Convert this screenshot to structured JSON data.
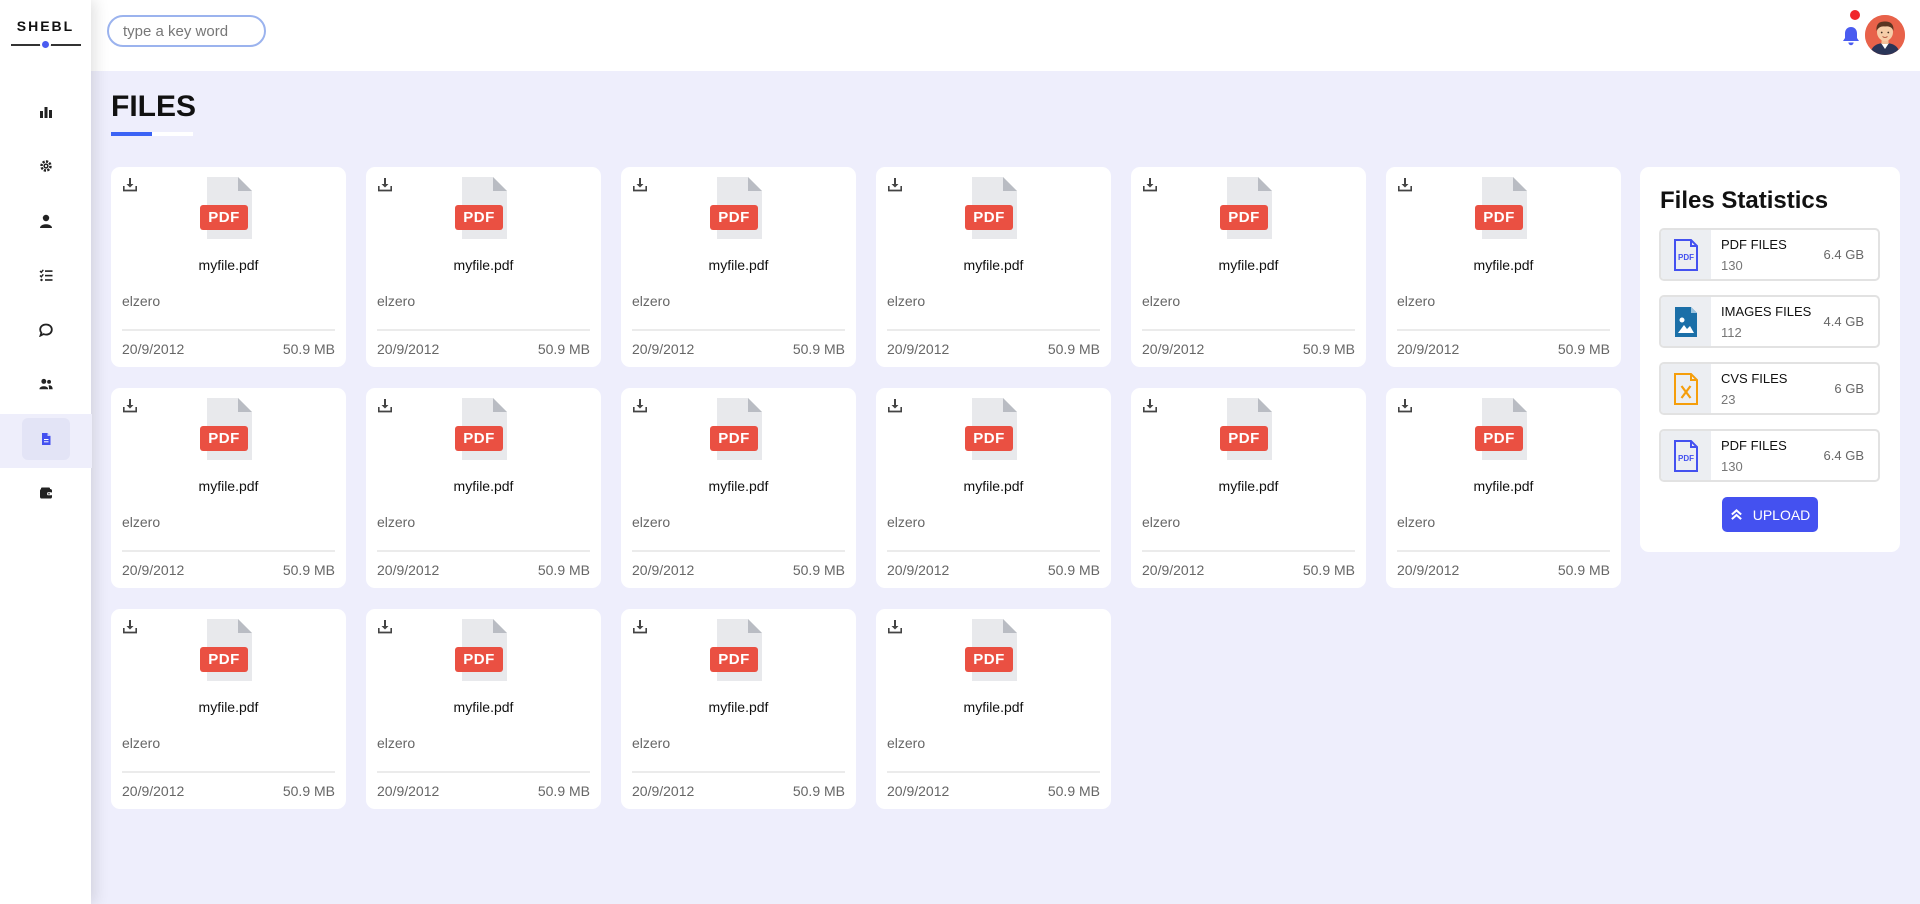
{
  "brand": {
    "name": "SHEBL"
  },
  "colors": {
    "accent": "#4451f0",
    "pdf_badge": "#ea5042",
    "background": "#eeeefc",
    "notification": "#f0262a"
  },
  "sidebar": {
    "items": [
      {
        "icon": "chart-bar-icon",
        "active": false
      },
      {
        "icon": "gear-icon",
        "active": false
      },
      {
        "icon": "user-icon",
        "active": false
      },
      {
        "icon": "list-check-icon",
        "active": false
      },
      {
        "icon": "comment-icon",
        "active": false
      },
      {
        "icon": "users-icon",
        "active": false
      },
      {
        "icon": "file-icon",
        "active": true
      },
      {
        "icon": "wallet-icon",
        "active": false
      }
    ]
  },
  "header": {
    "search_placeholder": "type a key word",
    "bell_icon": "bell-icon",
    "avatar_icon": "avatar-icon"
  },
  "page": {
    "title": "FILES"
  },
  "files": [
    {
      "badge": "PDF",
      "name": "myfile.pdf",
      "owner": "elzero",
      "date": "20/9/2012",
      "size": "50.9 MB"
    },
    {
      "badge": "PDF",
      "name": "myfile.pdf",
      "owner": "elzero",
      "date": "20/9/2012",
      "size": "50.9 MB"
    },
    {
      "badge": "PDF",
      "name": "myfile.pdf",
      "owner": "elzero",
      "date": "20/9/2012",
      "size": "50.9 MB"
    },
    {
      "badge": "PDF",
      "name": "myfile.pdf",
      "owner": "elzero",
      "date": "20/9/2012",
      "size": "50.9 MB"
    },
    {
      "badge": "PDF",
      "name": "myfile.pdf",
      "owner": "elzero",
      "date": "20/9/2012",
      "size": "50.9 MB"
    },
    {
      "badge": "PDF",
      "name": "myfile.pdf",
      "owner": "elzero",
      "date": "20/9/2012",
      "size": "50.9 MB"
    },
    {
      "badge": "PDF",
      "name": "myfile.pdf",
      "owner": "elzero",
      "date": "20/9/2012",
      "size": "50.9 MB"
    },
    {
      "badge": "PDF",
      "name": "myfile.pdf",
      "owner": "elzero",
      "date": "20/9/2012",
      "size": "50.9 MB"
    },
    {
      "badge": "PDF",
      "name": "myfile.pdf",
      "owner": "elzero",
      "date": "20/9/2012",
      "size": "50.9 MB"
    },
    {
      "badge": "PDF",
      "name": "myfile.pdf",
      "owner": "elzero",
      "date": "20/9/2012",
      "size": "50.9 MB"
    },
    {
      "badge": "PDF",
      "name": "myfile.pdf",
      "owner": "elzero",
      "date": "20/9/2012",
      "size": "50.9 MB"
    },
    {
      "badge": "PDF",
      "name": "myfile.pdf",
      "owner": "elzero",
      "date": "20/9/2012",
      "size": "50.9 MB"
    },
    {
      "badge": "PDF",
      "name": "myfile.pdf",
      "owner": "elzero",
      "date": "20/9/2012",
      "size": "50.9 MB"
    },
    {
      "badge": "PDF",
      "name": "myfile.pdf",
      "owner": "elzero",
      "date": "20/9/2012",
      "size": "50.9 MB"
    },
    {
      "badge": "PDF",
      "name": "myfile.pdf",
      "owner": "elzero",
      "date": "20/9/2012",
      "size": "50.9 MB"
    },
    {
      "badge": "PDF",
      "name": "myfile.pdf",
      "owner": "elzero",
      "date": "20/9/2012",
      "size": "50.9 MB"
    }
  ],
  "stats": {
    "title": "Files Statistics",
    "items": [
      {
        "icon": "pdf-file-icon",
        "color": "#4451f0",
        "label": "PDF FILES",
        "count": "130",
        "size": "6.4 GB"
      },
      {
        "icon": "image-file-icon",
        "color": "#1b6fa8",
        "label": "IMAGES FILES",
        "count": "112",
        "size": "4.4 GB"
      },
      {
        "icon": "csv-file-icon",
        "color": "#f59e0b",
        "label": "CVS FILES",
        "count": "23",
        "size": "6 GB"
      },
      {
        "icon": "pdf-file-icon",
        "color": "#4451f0",
        "label": "PDF FILES",
        "count": "130",
        "size": "6.4 GB"
      }
    ],
    "upload_label": "UPLOAD"
  }
}
